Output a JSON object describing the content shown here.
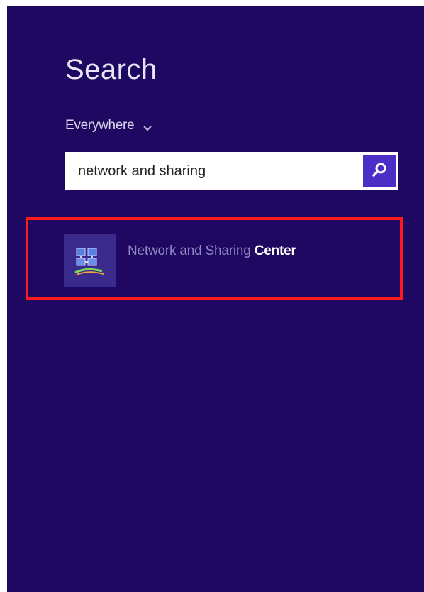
{
  "search_pane": {
    "title": "Search",
    "scope": {
      "label": "Everywhere",
      "icon": "chevron-down-icon"
    },
    "search_box": {
      "value": "network and sharing",
      "button_icon": "search-icon",
      "button_color": "#4b2ec6"
    },
    "results": [
      {
        "label_dim": "Network and Sharing ",
        "label_bold": "Center",
        "icon": "network-sharing-center-icon"
      }
    ],
    "background_color": "#1f0861",
    "highlight_color": "#ff1a1a"
  }
}
